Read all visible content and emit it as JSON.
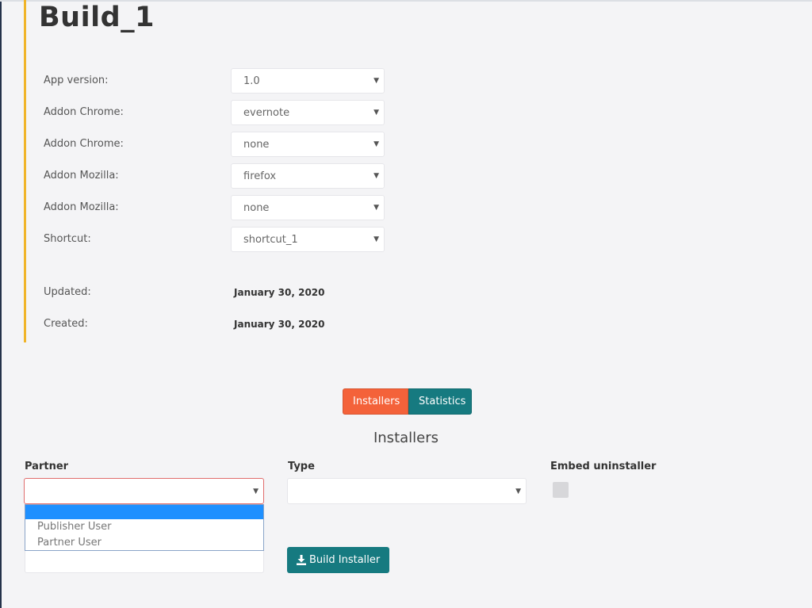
{
  "build": {
    "title": "Build_1",
    "fields": [
      {
        "label": "App version:",
        "value": "1.0"
      },
      {
        "label": "Addon Chrome:",
        "value": "evernote"
      },
      {
        "label": "Addon Chrome:",
        "value": "none"
      },
      {
        "label": "Addon Mozilla:",
        "value": "firefox"
      },
      {
        "label": "Addon Mozilla:",
        "value": "none"
      },
      {
        "label": "Shortcut:",
        "value": "shortcut_1"
      }
    ],
    "updated": {
      "label": "Updated:",
      "value": "January 30, 2020"
    },
    "created": {
      "label": "Created:",
      "value": "January 30, 2020"
    }
  },
  "tabs": {
    "installers": "Installers",
    "statistics": "Statistics"
  },
  "installers_section": {
    "title": "Installers",
    "partner_label": "Partner",
    "type_label": "Type",
    "embed_label": "Embed uninstaller",
    "partner_options": [
      "",
      "Publisher User",
      "Partner User"
    ],
    "build_button": "Build Installer"
  },
  "icons": {
    "caret": "chevron-down-icon",
    "download": "download-icon"
  },
  "colors": {
    "accent_border": "#f0b429",
    "installers_tab": "#f4623a",
    "teal": "#167a80",
    "dropdown_highlight": "#1e90ff",
    "partner_border_error": "#e06c6c"
  }
}
